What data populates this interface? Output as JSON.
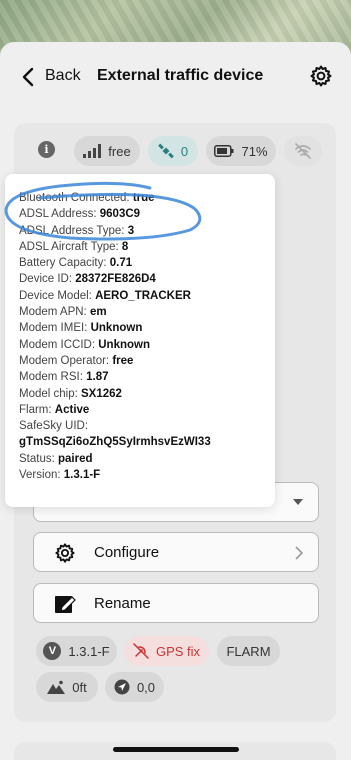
{
  "header": {
    "back_label": "Back",
    "title": "External traffic device"
  },
  "status_chips": {
    "network": "free",
    "satellites": "0",
    "battery": "71%"
  },
  "details": [
    {
      "key": "Bluetooth Connected:",
      "value": "true"
    },
    {
      "key": "ADSL Address:",
      "value": "9603C9"
    },
    {
      "key": "ADSL Address Type:",
      "value": "3"
    },
    {
      "key": "ADSL Aircraft Type:",
      "value": "8"
    },
    {
      "key": "Battery Capacity:",
      "value": "0.71"
    },
    {
      "key": "Device ID:",
      "value": "28372FE826D4"
    },
    {
      "key": "Device Model:",
      "value": "AERO_TRACKER"
    },
    {
      "key": "Modem APN:",
      "value": "em"
    },
    {
      "key": "Modem IMEI:",
      "value": "Unknown"
    },
    {
      "key": "Modem ICCID:",
      "value": "Unknown"
    },
    {
      "key": "Modem Operator:",
      "value": "free"
    },
    {
      "key": "Modem RSI:",
      "value": "1.87"
    },
    {
      "key": "Model chip:",
      "value": "SX1262"
    },
    {
      "key": "Flarm:",
      "value": "Active"
    },
    {
      "key": "SafeSky UID:",
      "value": ""
    },
    {
      "key": "",
      "value": "gTmSSqZi6oZhQ5SyIrmhsvEzWI33"
    },
    {
      "key": "Status:",
      "value": "paired"
    },
    {
      "key": "Version:",
      "value": "1.3.1-F"
    }
  ],
  "actions": {
    "configure": "Configure",
    "rename": "Rename"
  },
  "bottom_chips": {
    "version": "1.3.1-F",
    "gps": "GPS fix",
    "flarm": "FLARM",
    "altitude": "0ft",
    "heading": "0,0"
  },
  "colors": {
    "accent_teal": "#2a7f7f",
    "error_red": "#cc3333",
    "annotation_blue": "#3a86d8"
  }
}
